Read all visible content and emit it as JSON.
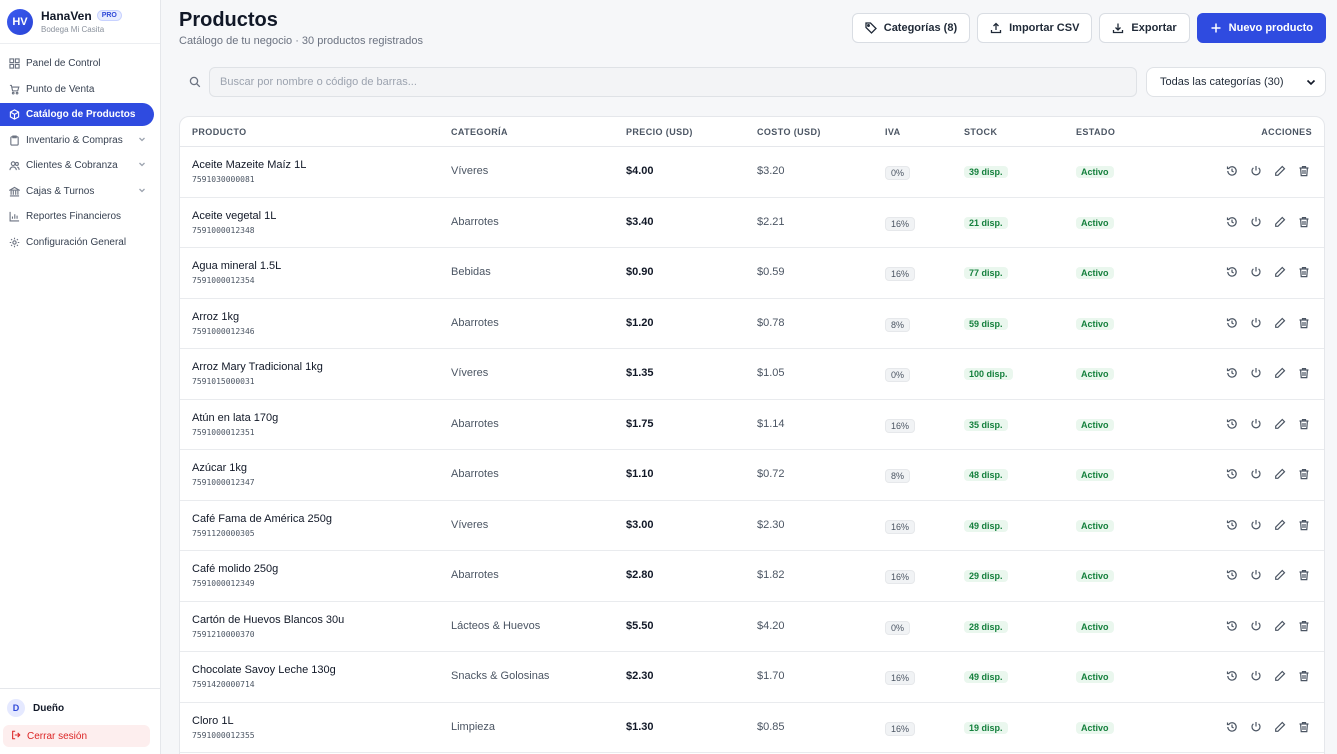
{
  "brand": {
    "logo": "HV",
    "name": "HanaVen",
    "badge": "PRO",
    "store": "Bodega Mi Casita"
  },
  "nav": [
    {
      "label": "Panel de Control",
      "icon": "grid-icon",
      "chevron": false,
      "active": false
    },
    {
      "label": "Punto de Venta",
      "icon": "cart-icon",
      "chevron": false,
      "active": false
    },
    {
      "label": "Catálogo de Productos",
      "icon": "box-icon",
      "chevron": false,
      "active": true
    },
    {
      "label": "Inventario & Compras",
      "icon": "clipboard-icon",
      "chevron": true,
      "active": false
    },
    {
      "label": "Clientes & Cobranza",
      "icon": "users-icon",
      "chevron": true,
      "active": false
    },
    {
      "label": "Cajas & Turnos",
      "icon": "bank-icon",
      "chevron": true,
      "active": false
    },
    {
      "label": "Reportes Financieros",
      "icon": "bar-chart-icon",
      "chevron": false,
      "active": false
    },
    {
      "label": "Configuración General",
      "icon": "gear-icon",
      "chevron": false,
      "active": false
    }
  ],
  "user": {
    "initial": "D",
    "role": "Dueño",
    "logout": "Cerrar sesión"
  },
  "header": {
    "title": "Productos",
    "subtitle": "Catálogo de tu negocio · 30 productos registrados",
    "btn_categories": "Categorías (8)",
    "btn_import": "Importar CSV",
    "btn_export": "Exportar",
    "btn_new": "Nuevo producto"
  },
  "search": {
    "placeholder": "Buscar por nombre o código de barras...",
    "category_filter": "Todas las categorías (30)"
  },
  "table": {
    "columns": [
      "PRODUCTO",
      "CATEGORÍA",
      "PRECIO (USD)",
      "COSTO (USD)",
      "IVA",
      "STOCK",
      "ESTADO",
      "ACCIONES"
    ],
    "rows": [
      {
        "name": "Aceite Mazeite Maíz 1L",
        "code": "7591030000081",
        "category": "Víveres",
        "price": "$4.00",
        "cost": "$3.20",
        "iva": "0%",
        "stock": "39 disp.",
        "status": "Activo"
      },
      {
        "name": "Aceite vegetal 1L",
        "code": "7591000012348",
        "category": "Abarrotes",
        "price": "$3.40",
        "cost": "$2.21",
        "iva": "16%",
        "stock": "21 disp.",
        "status": "Activo"
      },
      {
        "name": "Agua mineral 1.5L",
        "code": "7591000012354",
        "category": "Bebidas",
        "price": "$0.90",
        "cost": "$0.59",
        "iva": "16%",
        "stock": "77 disp.",
        "status": "Activo"
      },
      {
        "name": "Arroz 1kg",
        "code": "7591000012346",
        "category": "Abarrotes",
        "price": "$1.20",
        "cost": "$0.78",
        "iva": "8%",
        "stock": "59 disp.",
        "status": "Activo"
      },
      {
        "name": "Arroz Mary Tradicional 1kg",
        "code": "7591015000031",
        "category": "Víveres",
        "price": "$1.35",
        "cost": "$1.05",
        "iva": "0%",
        "stock": "100 disp.",
        "status": "Activo"
      },
      {
        "name": "Atún en lata 170g",
        "code": "7591000012351",
        "category": "Abarrotes",
        "price": "$1.75",
        "cost": "$1.14",
        "iva": "16%",
        "stock": "35 disp.",
        "status": "Activo"
      },
      {
        "name": "Azúcar 1kg",
        "code": "7591000012347",
        "category": "Abarrotes",
        "price": "$1.10",
        "cost": "$0.72",
        "iva": "8%",
        "stock": "48 disp.",
        "status": "Activo"
      },
      {
        "name": "Café Fama de América 250g",
        "code": "7591120000305",
        "category": "Víveres",
        "price": "$3.00",
        "cost": "$2.30",
        "iva": "16%",
        "stock": "49 disp.",
        "status": "Activo"
      },
      {
        "name": "Café molido 250g",
        "code": "7591000012349",
        "category": "Abarrotes",
        "price": "$2.80",
        "cost": "$1.82",
        "iva": "16%",
        "stock": "29 disp.",
        "status": "Activo"
      },
      {
        "name": "Cartón de Huevos Blancos 30u",
        "code": "7591210000370",
        "category": "Lácteos & Huevos",
        "price": "$5.50",
        "cost": "$4.20",
        "iva": "0%",
        "stock": "28 disp.",
        "status": "Activo"
      },
      {
        "name": "Chocolate Savoy Leche 130g",
        "code": "7591420000714",
        "category": "Snacks & Golosinas",
        "price": "$2.30",
        "cost": "$1.70",
        "iva": "16%",
        "stock": "49 disp.",
        "status": "Activo"
      },
      {
        "name": "Cloro 1L",
        "code": "7591000012355",
        "category": "Limpieza",
        "price": "$1.30",
        "cost": "$0.85",
        "iva": "16%",
        "stock": "19 disp.",
        "status": "Activo"
      }
    ],
    "row_actions": [
      "history-icon",
      "power-icon",
      "pencil-icon",
      "trash-icon"
    ]
  },
  "colors": {
    "accent": "#2f4be0",
    "success": "#15803d",
    "danger": "#dc2626"
  }
}
